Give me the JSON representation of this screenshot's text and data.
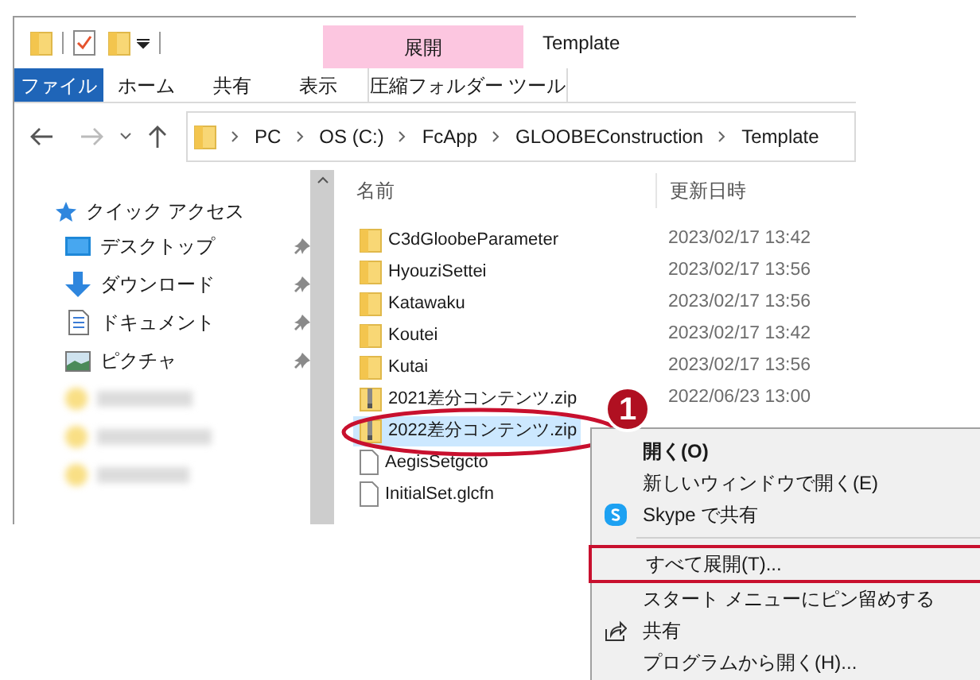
{
  "window": {
    "title": "Template"
  },
  "ribbon": {
    "context_group": "展開",
    "tabs": [
      {
        "label": "ファイル",
        "kind": "file"
      },
      {
        "label": "ホーム",
        "kind": "normal"
      },
      {
        "label": "共有",
        "kind": "normal"
      },
      {
        "label": "表示",
        "kind": "normal"
      },
      {
        "label": "圧縮フォルダー ツール",
        "kind": "context"
      }
    ]
  },
  "address_bar": {
    "path": [
      "PC",
      "OS (C:)",
      "FcApp",
      "GLOOBEConstruction",
      "Template"
    ]
  },
  "navigation_pane": {
    "header": "クイック アクセス",
    "items": [
      {
        "label": "デスクトップ",
        "kind": "desktop",
        "pinned": true
      },
      {
        "label": "ダウンロード",
        "kind": "download",
        "pinned": true
      },
      {
        "label": "ドキュメント",
        "kind": "document",
        "pinned": true
      },
      {
        "label": "ピクチャ",
        "kind": "picture",
        "pinned": true
      }
    ]
  },
  "file_list": {
    "columns": [
      "名前",
      "更新日時"
    ],
    "rows": [
      {
        "kind": "folder",
        "name": "C3dGloobeParameter",
        "modified": "2023/02/17 13:42",
        "selected": false
      },
      {
        "kind": "folder",
        "name": "HyouziSettei",
        "modified": "2023/02/17 13:56",
        "selected": false
      },
      {
        "kind": "folder",
        "name": "Katawaku",
        "modified": "2023/02/17 13:56",
        "selected": false
      },
      {
        "kind": "folder",
        "name": "Koutei",
        "modified": "2023/02/17 13:42",
        "selected": false
      },
      {
        "kind": "folder",
        "name": "Kutai",
        "modified": "2023/02/17 13:56",
        "selected": false
      },
      {
        "kind": "zip",
        "name": "2021差分コンテンツ.zip",
        "modified": "2022/06/23 13:00",
        "selected": false
      },
      {
        "kind": "zip",
        "name": "2022差分コンテンツ.zip",
        "selected": true
      },
      {
        "kind": "file",
        "name": "AegisSetgcto",
        "selected": false
      },
      {
        "kind": "file",
        "name": "InitialSet.glcfn",
        "selected": false
      }
    ]
  },
  "callout": {
    "number": "1"
  },
  "context_menu": {
    "items": [
      {
        "kind": "default",
        "label": "開く(O)",
        "highlighted": false
      },
      {
        "kind": "item",
        "label": "新しいウィンドウで開く(E)",
        "highlighted": false
      },
      {
        "kind": "skype",
        "label": "Skype で共有",
        "highlighted": false
      },
      {
        "kind": "separator"
      },
      {
        "kind": "item",
        "label": "すべて展開(T)...",
        "highlighted": true
      },
      {
        "kind": "item",
        "label": "スタート メニューにピン留めする",
        "highlighted": false
      },
      {
        "kind": "share",
        "label": "共有",
        "highlighted": false
      },
      {
        "kind": "item",
        "label": "プログラムから開く(H)...",
        "highlighted": false
      }
    ]
  }
}
